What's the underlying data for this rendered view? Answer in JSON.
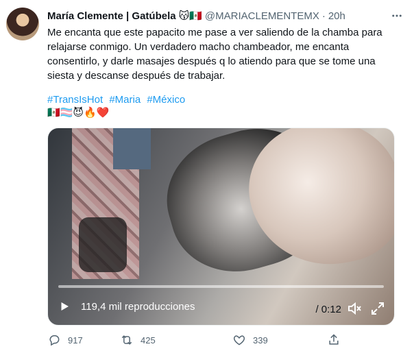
{
  "tweet": {
    "author_name": "María Clemente | Gatúbela",
    "author_emojis": "😽🇲🇽",
    "handle": "@MARIACLEMENTEMX",
    "separator": "·",
    "time": "20h",
    "text": "Me encanta que este papacito me pase a ver saliendo de la chamba para relajarse conmigo. Un verdadero macho chambeador, me encanta consentirlo, y darle masajes después q lo atiendo para que se tome una siesta y descanse después de trabajar.",
    "hashtags": [
      "#TransIsHot",
      "#Maria",
      "#México"
    ],
    "emoji_line": "🇲🇽🏳️‍⚧️😈🔥❤️"
  },
  "video": {
    "views": "119,4 mil reproducciones",
    "duration": "0:12",
    "duration_prefix": "/",
    "progress": 0
  },
  "actions": {
    "replies": "917",
    "retweets": "425",
    "likes": "339"
  },
  "colors": {
    "link": "#1d9bf0",
    "muted": "#536471",
    "text": "#0f1419"
  },
  "icons": {
    "more": "more-icon",
    "play": "play-icon",
    "volume": "volume-icon",
    "expand": "expand-icon",
    "reply": "reply-icon",
    "retweet": "retweet-icon",
    "like": "heart-icon",
    "share": "share-icon"
  }
}
